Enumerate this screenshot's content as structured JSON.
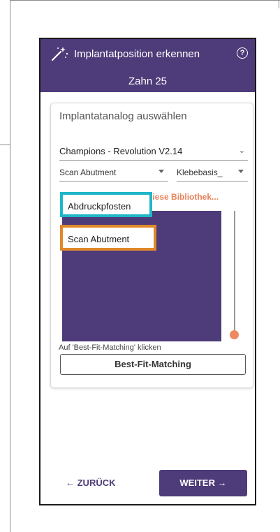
{
  "header": {
    "title": "Implantatposition erkennen",
    "subtitle": "Zahn 25",
    "help_symbol": "?",
    "icon": "magic-wand-icon"
  },
  "card": {
    "title": "Implantatanalog auswählen",
    "library_select": {
      "value": "Champions - Revolution V2.14",
      "chevron": "⌄"
    },
    "type_select": {
      "value": "Scan Abutment"
    },
    "base_select": {
      "value": "Klebebasis_"
    },
    "library_link": "liese Bibliothek...",
    "dropdown_options": [
      "Abdruckpfosten",
      "Scan Abutment"
    ],
    "hint": "Auf 'Best-Fit-Matching' klicken",
    "best_fit_button": "Best-Fit-Matching"
  },
  "footer": {
    "back_label": "← ZURÜCK",
    "next_label": "WEITER →"
  },
  "colors": {
    "header_bg": "#4e3b79",
    "accent_orange": "#e8825a",
    "highlight_cyan": "#1fb6c8",
    "highlight_orange": "#e0882a"
  }
}
